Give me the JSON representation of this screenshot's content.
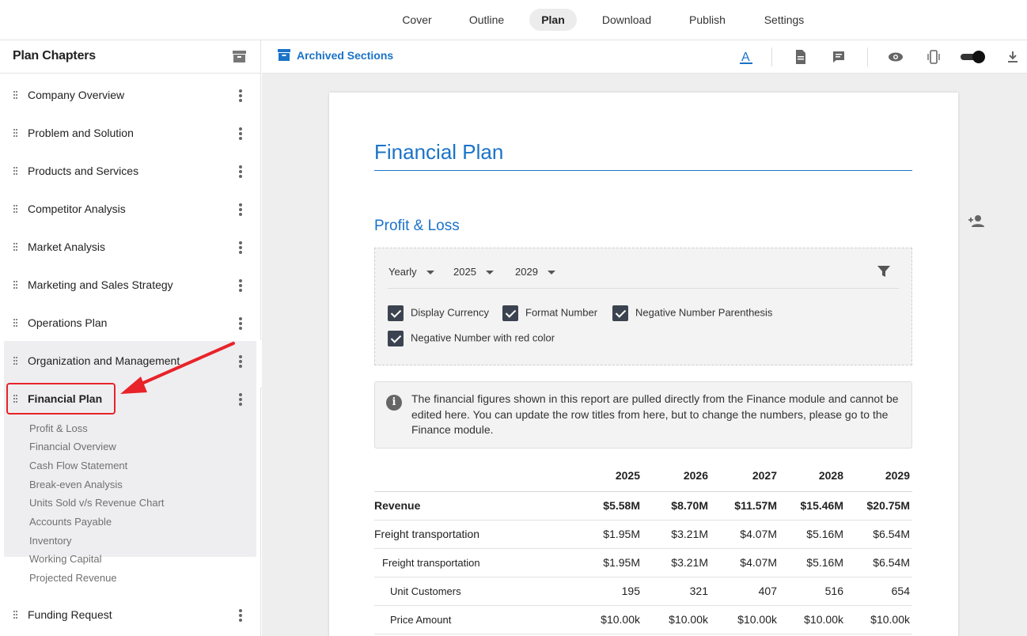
{
  "topnav": {
    "tabs": [
      {
        "label": "Cover"
      },
      {
        "label": "Outline"
      },
      {
        "label": "Plan"
      },
      {
        "label": "Download"
      },
      {
        "label": "Publish"
      },
      {
        "label": "Settings"
      }
    ],
    "active": "Plan"
  },
  "sidebar": {
    "title": "Plan Chapters",
    "chapters": [
      {
        "label": "Company Overview"
      },
      {
        "label": "Problem and Solution"
      },
      {
        "label": "Products and Services"
      },
      {
        "label": "Competitor Analysis"
      },
      {
        "label": "Market Analysis"
      },
      {
        "label": "Marketing and Sales Strategy"
      },
      {
        "label": "Operations Plan"
      },
      {
        "label": "Organization and Management"
      },
      {
        "label": "Financial Plan"
      },
      {
        "label": "Funding Request"
      }
    ],
    "financial_sections": [
      "Profit & Loss",
      "Financial Overview",
      "Cash Flow Statement",
      "Break-even Analysis",
      "Units Sold v/s Revenue Chart",
      "Accounts Payable",
      "Inventory",
      "Working Capital",
      "Projected Revenue"
    ]
  },
  "toolbar": {
    "archived_label": "Archived Sections",
    "toggle_on": true
  },
  "document": {
    "title": "Financial Plan",
    "section_title": "Profit & Loss",
    "filters": {
      "period": "Yearly",
      "start_year": "2025",
      "end_year": "2029"
    },
    "checkboxes": [
      {
        "label": "Display Currency",
        "checked": true
      },
      {
        "label": "Format Number",
        "checked": true
      },
      {
        "label": "Negative Number Parenthesis",
        "checked": true
      },
      {
        "label": "Negative Number with red color",
        "checked": true
      }
    ],
    "info_text": "The financial figures shown in this report are pulled directly from the Finance module and cannot be edited here. You can update the row titles from here, but to change the numbers, please go to the Finance module.",
    "table": {
      "columns": [
        "",
        "2025",
        "2026",
        "2027",
        "2028",
        "2029"
      ],
      "rows": [
        {
          "cells": [
            "Revenue",
            "$5.58M",
            "$8.70M",
            "$11.57M",
            "$15.46M",
            "$20.75M"
          ]
        },
        {
          "cells": [
            "Freight transportation",
            "$1.95M",
            "$3.21M",
            "$4.07M",
            "$5.16M",
            "$6.54M"
          ]
        },
        {
          "cells": [
            "Freight transportation",
            "$1.95M",
            "$3.21M",
            "$4.07M",
            "$5.16M",
            "$6.54M"
          ]
        },
        {
          "cells": [
            "Unit Customers",
            "195",
            "321",
            "407",
            "516",
            "654"
          ]
        },
        {
          "cells": [
            "Price Amount",
            "$10.00k",
            "$10.00k",
            "$10.00k",
            "$10.00k",
            "$10.00k"
          ]
        }
      ]
    }
  },
  "colors": {
    "accent": "#1a73c8",
    "highlight": "#e8232a",
    "checkbox": "#3c4350"
  }
}
